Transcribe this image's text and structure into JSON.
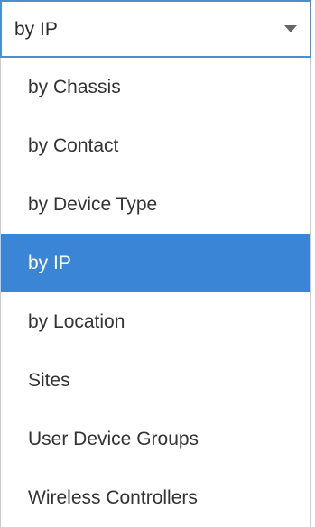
{
  "select": {
    "value": "by IP"
  },
  "options": [
    {
      "label": "by Chassis",
      "selected": false
    },
    {
      "label": "by Contact",
      "selected": false
    },
    {
      "label": "by Device Type",
      "selected": false
    },
    {
      "label": "by IP",
      "selected": true
    },
    {
      "label": "by Location",
      "selected": false
    },
    {
      "label": "Sites",
      "selected": false
    },
    {
      "label": "User Device Groups",
      "selected": false
    },
    {
      "label": "Wireless Controllers",
      "selected": false
    }
  ],
  "colors": {
    "focus_border": "#4a8fd1",
    "selected_background": "#3a85d6",
    "selected_text": "#ffffff",
    "text": "#333333"
  },
  "icons": {
    "dropdown_arrow": "chevron-down-icon"
  }
}
